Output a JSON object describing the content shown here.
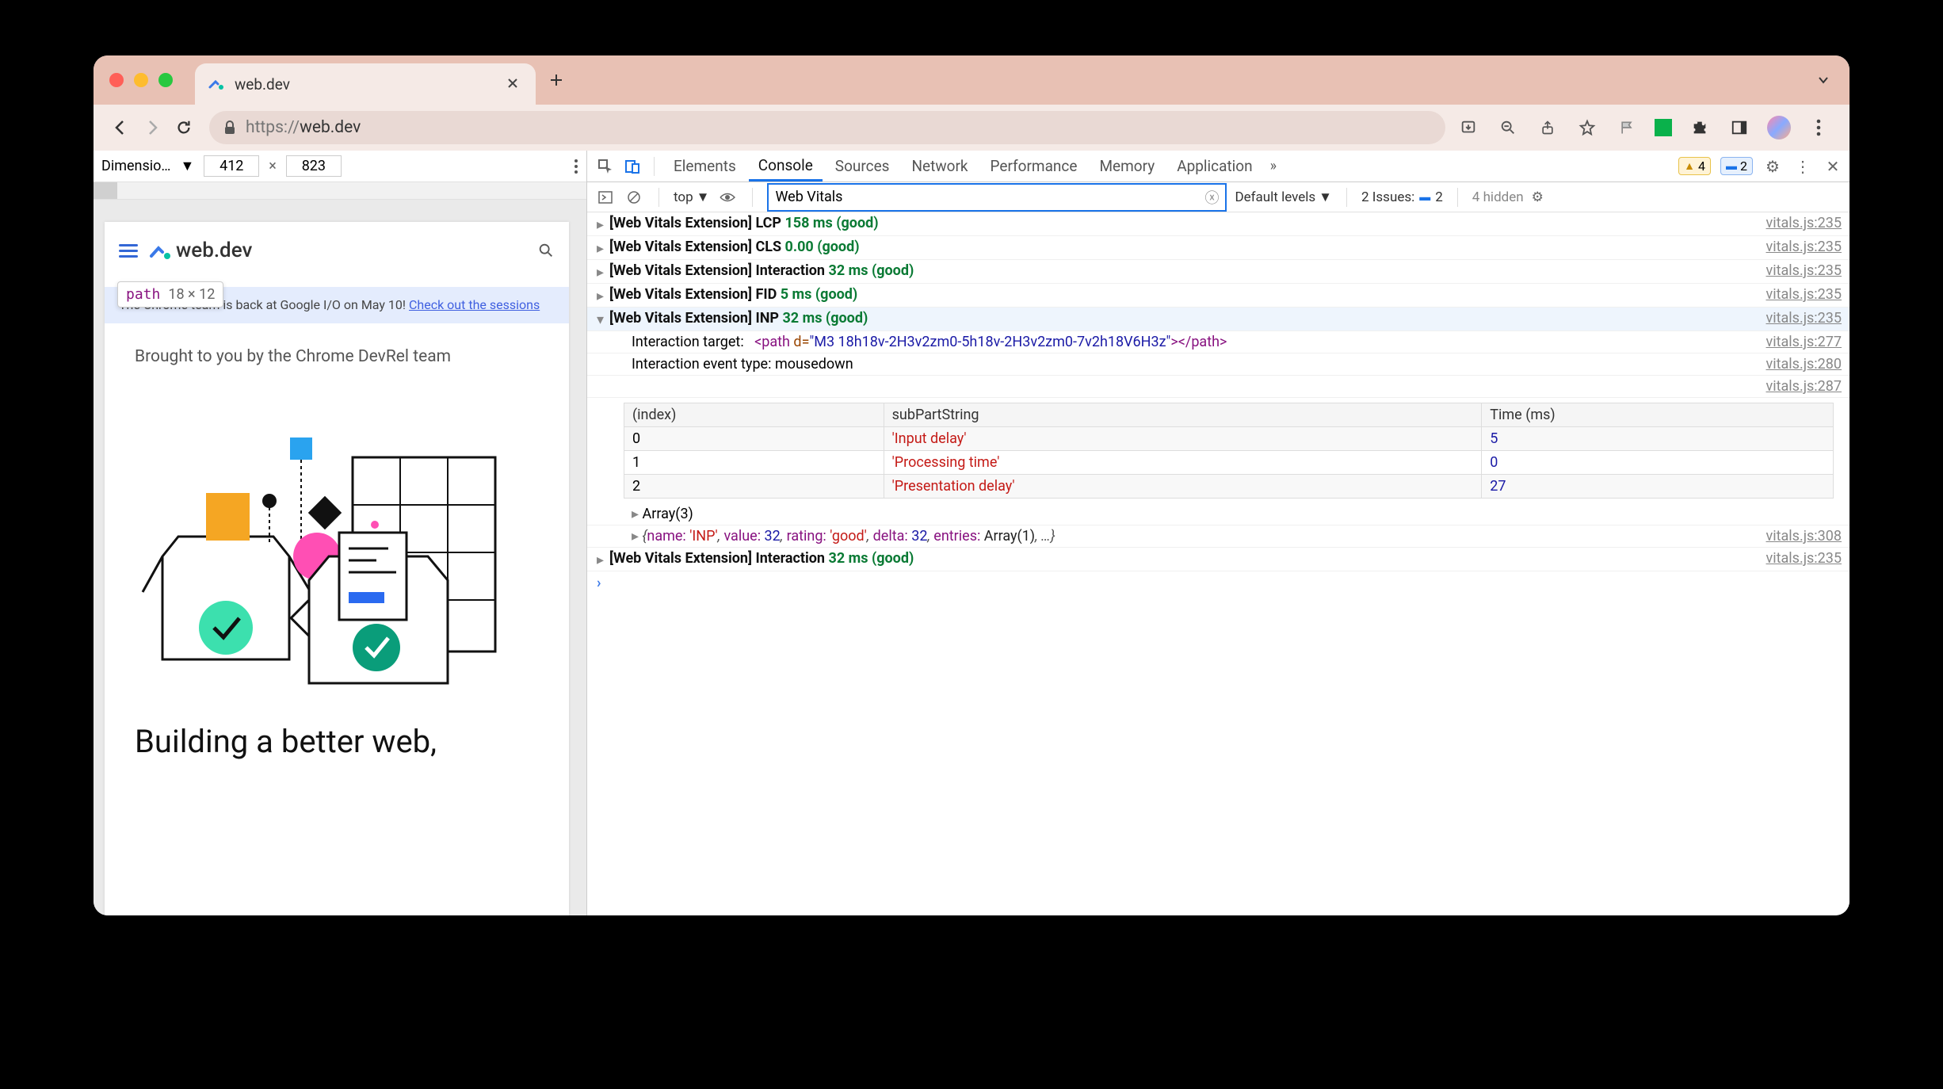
{
  "browser": {
    "tab_title": "web.dev",
    "url_proto": "https://",
    "url_host": "web.dev"
  },
  "device_toolbar": {
    "dimensions_label": "Dimensio…",
    "width": "412",
    "height": "823",
    "separator": "×"
  },
  "hover_tooltip": {
    "tag": "path",
    "dims": "18 × 12"
  },
  "page": {
    "logo_text": "web.dev",
    "banner_prefix": "The Chrome team is back at Google I/O on May 10! ",
    "banner_link": "Check out the sessions",
    "credit": "Brought to you by the Chrome DevRel team",
    "headline": "Building a better web,"
  },
  "devtools": {
    "tabs": [
      "Elements",
      "Console",
      "Sources",
      "Network",
      "Performance",
      "Memory",
      "Application"
    ],
    "active_tab": "Console",
    "warn_count": "4",
    "info_count": "2"
  },
  "console_toolbar": {
    "context": "top",
    "filter_value": "Web Vitals",
    "levels": "Default levels",
    "issues_label": "2 Issues:",
    "issues_count": "2",
    "hidden": "4 hidden"
  },
  "console": {
    "src235": "vitals.js:235",
    "src277": "vitals.js:277",
    "src280": "vitals.js:280",
    "src287": "vitals.js:287",
    "src308": "vitals.js:308",
    "prefix": "[Web Vitals Extension]",
    "rows": {
      "lcp": {
        "metric": "LCP",
        "value": "158 ms (good)"
      },
      "cls": {
        "metric": "CLS",
        "value": "0.00 (good)"
      },
      "int1": {
        "metric": "Interaction",
        "value": "32 ms (good)"
      },
      "fid": {
        "metric": "FID",
        "value": "5 ms (good)"
      },
      "inp": {
        "metric": "INP",
        "value": "32 ms (good)"
      },
      "int2": {
        "metric": "Interaction",
        "value": "32 ms (good)"
      }
    },
    "detail": {
      "target_label": "Interaction target:",
      "target_tag_open": "<path",
      "target_attr": "d",
      "target_val": "\"M3 18h18v-2H3v2zm0-5h18v-2H3v2zm0-7v2h18V6H3z\"",
      "target_tag_close": "></path>",
      "event_label": "Interaction event type:",
      "event_value": "mousedown",
      "array_label": "Array(3)"
    },
    "table": {
      "headers": {
        "idx": "(index)",
        "sub": "subPartString",
        "time": "Time (ms)"
      },
      "r0": {
        "idx": "0",
        "sub": "'Input delay'",
        "time": "5"
      },
      "r1": {
        "idx": "1",
        "sub": "'Processing time'",
        "time": "0"
      },
      "r2": {
        "idx": "2",
        "sub": "'Presentation delay'",
        "time": "27"
      }
    },
    "object": {
      "open": "{",
      "name_k": "name:",
      "name_v": "'INP'",
      "value_k": "value:",
      "value_v": "32",
      "rating_k": "rating:",
      "rating_v": "'good'",
      "delta_k": "delta:",
      "delta_v": "32",
      "entries_k": "entries:",
      "entries_v": "Array(1)",
      "close": ", …}"
    }
  }
}
